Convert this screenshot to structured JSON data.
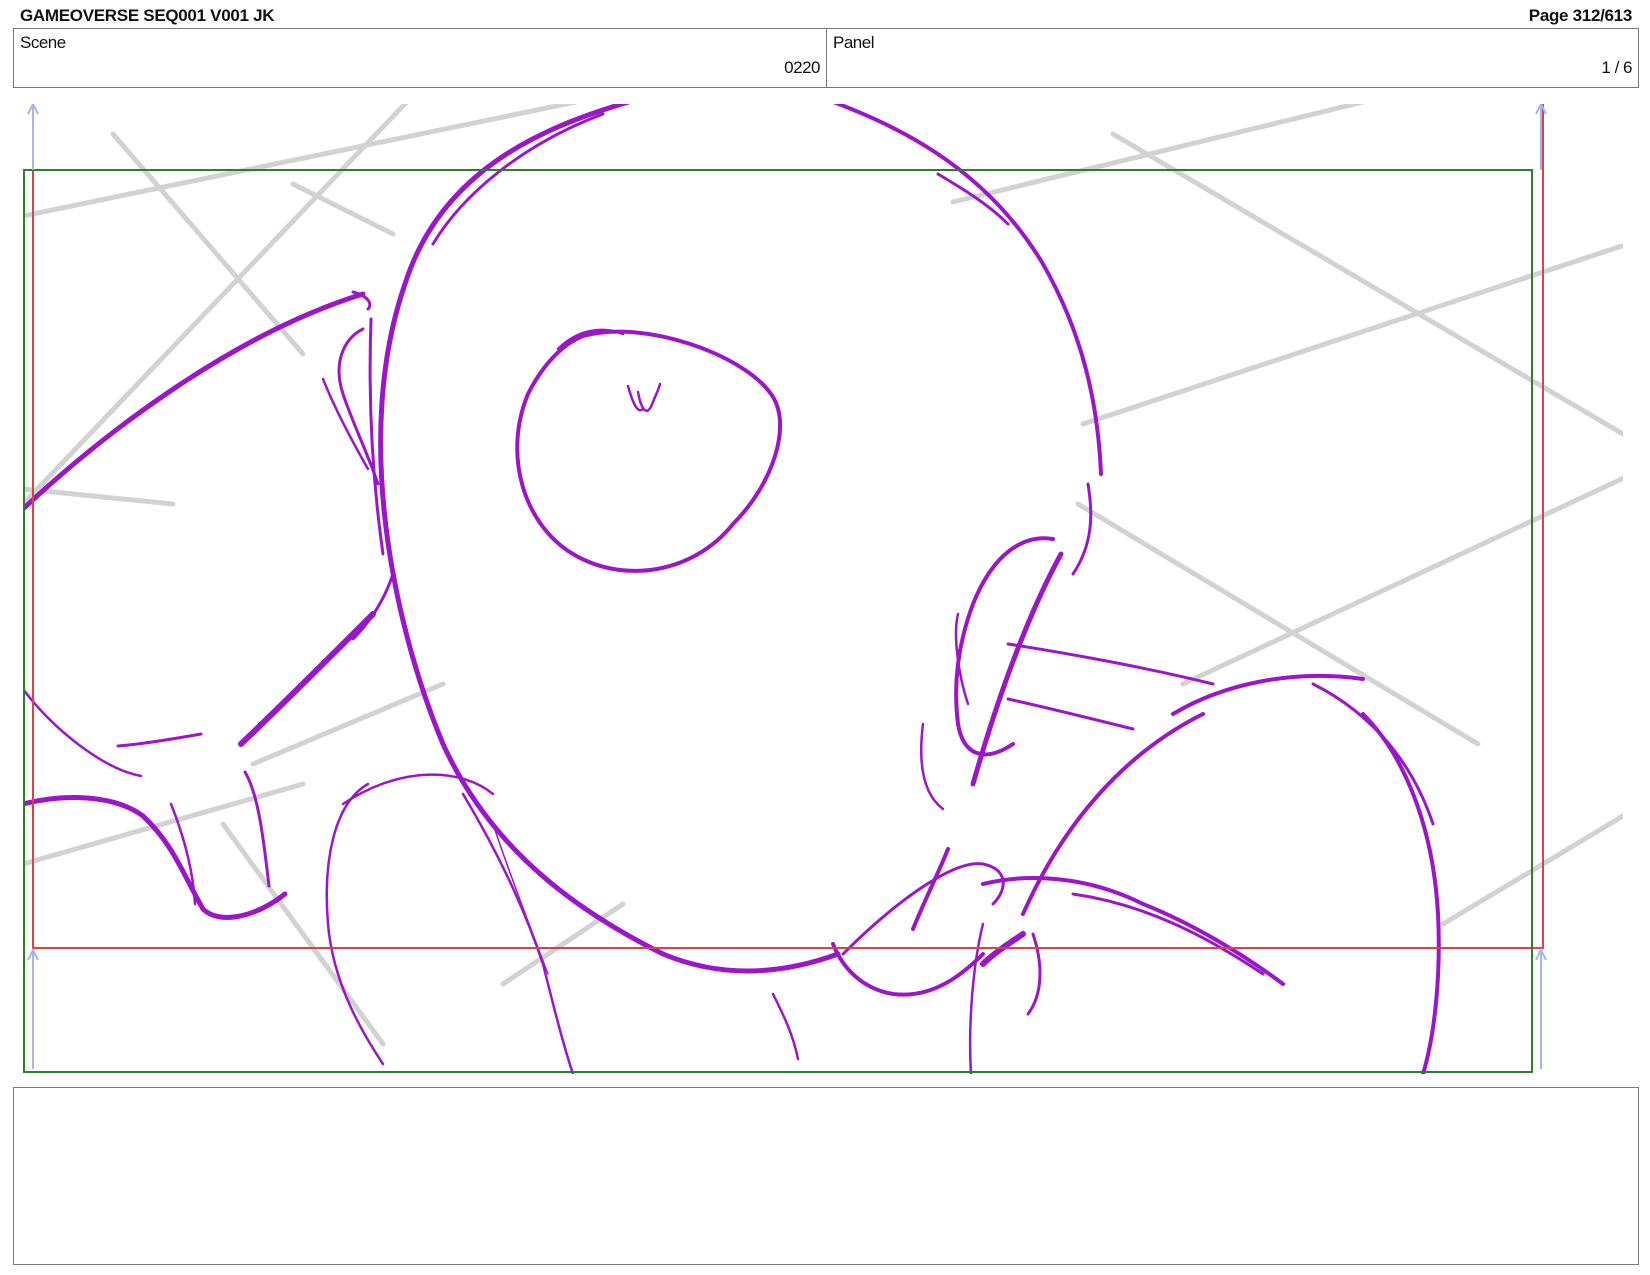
{
  "header": {
    "title": "GAMEOVERSE SEQ001 V001 JK",
    "page": "Page 312/613"
  },
  "info": {
    "scene_label": "Scene",
    "scene_value": "0220",
    "panel_label": "Panel",
    "panel_value": "1 / 6"
  },
  "colors": {
    "sketch": "#9b16c8",
    "perspective_grid": "#d2d2d2",
    "safe_frame": "#d64545",
    "camera_frame": "#2f7d2f",
    "frame_arrow": "#a9b4ea"
  },
  "notes": {
    "dialogue": ""
  }
}
